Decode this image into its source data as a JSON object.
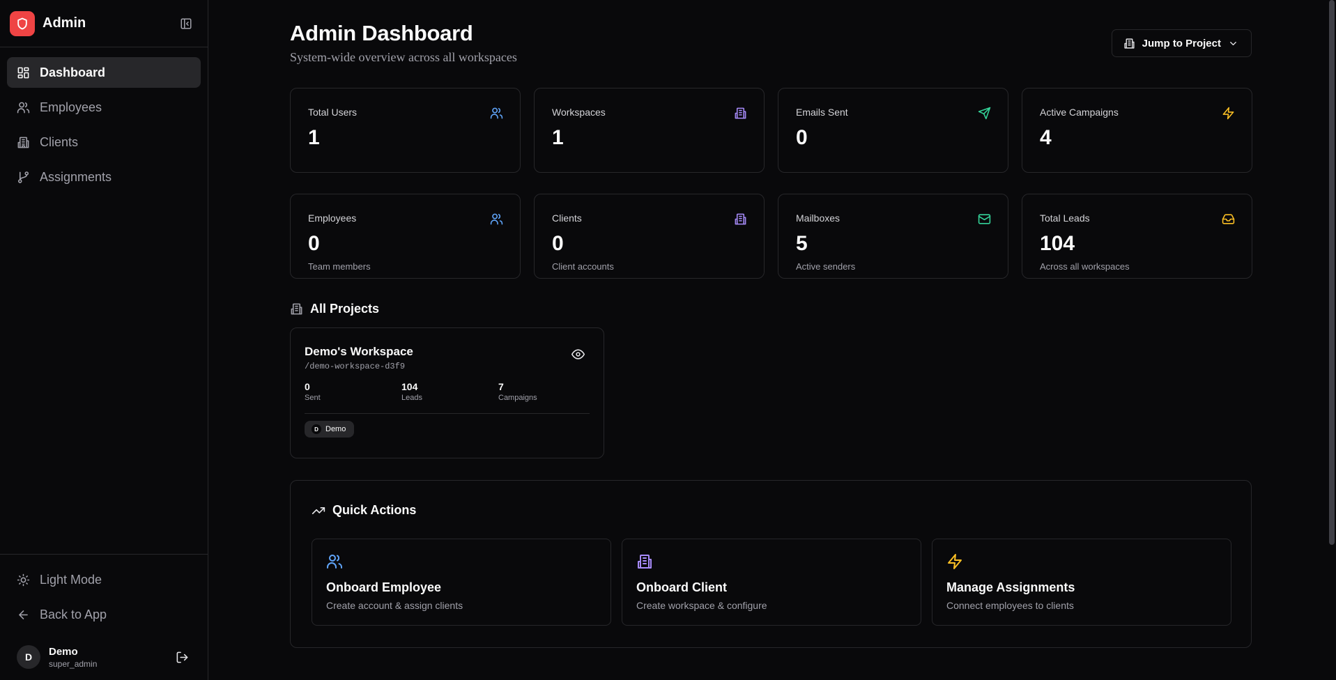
{
  "sidebar": {
    "brand": "Admin",
    "nav": [
      {
        "label": "Dashboard",
        "icon": "dashboard-icon"
      },
      {
        "label": "Employees",
        "icon": "users-icon"
      },
      {
        "label": "Clients",
        "icon": "building-icon"
      },
      {
        "label": "Assignments",
        "icon": "git-branch-icon"
      }
    ],
    "footer": [
      {
        "label": "Light Mode",
        "icon": "sun-icon"
      },
      {
        "label": "Back to App",
        "icon": "arrow-left-icon"
      }
    ],
    "user": {
      "initial": "D",
      "name": "Demo",
      "role": "super_admin"
    }
  },
  "header": {
    "title": "Admin Dashboard",
    "subtitle": "System-wide overview across all workspaces",
    "jump_label": "Jump to Project"
  },
  "stats": [
    {
      "label": "Total Users",
      "value": "1",
      "sub": "",
      "icon": "users-icon",
      "color": "#60a5fa"
    },
    {
      "label": "Workspaces",
      "value": "1",
      "sub": "",
      "icon": "building-icon",
      "color": "#a78bfa"
    },
    {
      "label": "Emails Sent",
      "value": "0",
      "sub": "",
      "icon": "send-icon",
      "color": "#34d399"
    },
    {
      "label": "Active Campaigns",
      "value": "4",
      "sub": "",
      "icon": "zap-icon",
      "color": "#fbbf24"
    },
    {
      "label": "Employees",
      "value": "0",
      "sub": "Team members",
      "icon": "users-icon",
      "color": "#60a5fa"
    },
    {
      "label": "Clients",
      "value": "0",
      "sub": "Client accounts",
      "icon": "building-icon",
      "color": "#a78bfa"
    },
    {
      "label": "Mailboxes",
      "value": "5",
      "sub": "Active senders",
      "icon": "mail-icon",
      "color": "#34d399"
    },
    {
      "label": "Total Leads",
      "value": "104",
      "sub": "Across all workspaces",
      "icon": "inbox-icon",
      "color": "#fbbf24"
    }
  ],
  "projects": {
    "title": "All Projects",
    "items": [
      {
        "name": "Demo's Workspace",
        "slug": "/demo-workspace-d3f9",
        "stats": [
          {
            "value": "0",
            "label": "Sent"
          },
          {
            "value": "104",
            "label": "Leads"
          },
          {
            "value": "7",
            "label": "Campaigns"
          }
        ],
        "member": {
          "initial": "D",
          "name": "Demo"
        }
      }
    ]
  },
  "quick_actions": {
    "title": "Quick Actions",
    "items": [
      {
        "title": "Onboard Employee",
        "desc": "Create account & assign clients",
        "icon": "users-icon",
        "color": "#60a5fa"
      },
      {
        "title": "Onboard Client",
        "desc": "Create workspace & configure",
        "icon": "building-icon",
        "color": "#a78bfa"
      },
      {
        "title": "Manage Assignments",
        "desc": "Connect employees to clients",
        "icon": "zap-icon",
        "color": "#fbbf24"
      }
    ]
  }
}
